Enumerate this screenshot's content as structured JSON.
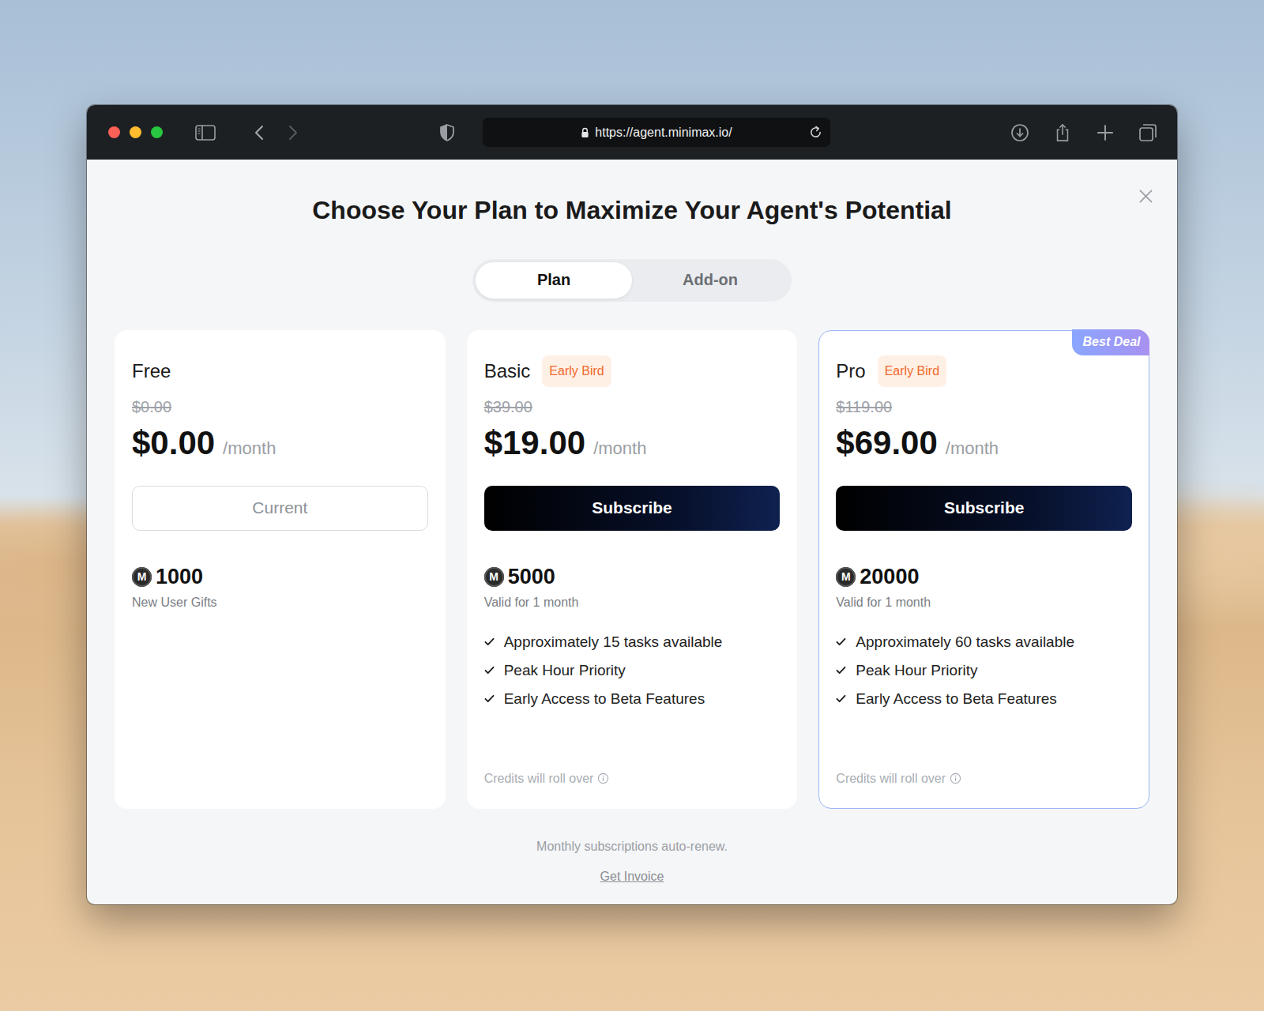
{
  "browser": {
    "url": "https://agent.minimax.io/"
  },
  "dialog": {
    "title": "Choose Your Plan to Maximize Your Agent's Potential"
  },
  "tabs": [
    {
      "label": "Plan",
      "selected": true
    },
    {
      "label": "Add-on",
      "selected": false
    }
  ],
  "credit_symbol": "M",
  "plans": [
    {
      "name": "Free",
      "badge": "",
      "ribbon": "",
      "highlighted": false,
      "original_price": "$0.00",
      "price": "$0.00",
      "period": "/month",
      "button": {
        "label": "Current",
        "kind": "current"
      },
      "credits": "1000",
      "credits_note": "New User Gifts",
      "features": [],
      "rollover": ""
    },
    {
      "name": "Basic",
      "badge": "Early Bird",
      "ribbon": "",
      "highlighted": false,
      "original_price": "$39.00",
      "price": "$19.00",
      "period": "/month",
      "button": {
        "label": "Subscribe",
        "kind": "subscribe"
      },
      "credits": "5000",
      "credits_note": "Valid for 1 month",
      "features": [
        "Approximately 15 tasks available",
        "Peak Hour Priority",
        "Early Access to Beta Features"
      ],
      "rollover": "Credits will roll over"
    },
    {
      "name": "Pro",
      "badge": "Early Bird",
      "ribbon": "Best Deal",
      "highlighted": true,
      "original_price": "$119.00",
      "price": "$69.00",
      "period": "/month",
      "button": {
        "label": "Subscribe",
        "kind": "subscribe"
      },
      "credits": "20000",
      "credits_note": "Valid for 1 month",
      "features": [
        "Approximately 60 tasks available",
        "Peak Hour Priority",
        "Early Access to Beta Features"
      ],
      "rollover": "Credits will roll over"
    }
  ],
  "footer": {
    "note": "Monthly subscriptions auto-renew.",
    "link": "Get Invoice"
  }
}
